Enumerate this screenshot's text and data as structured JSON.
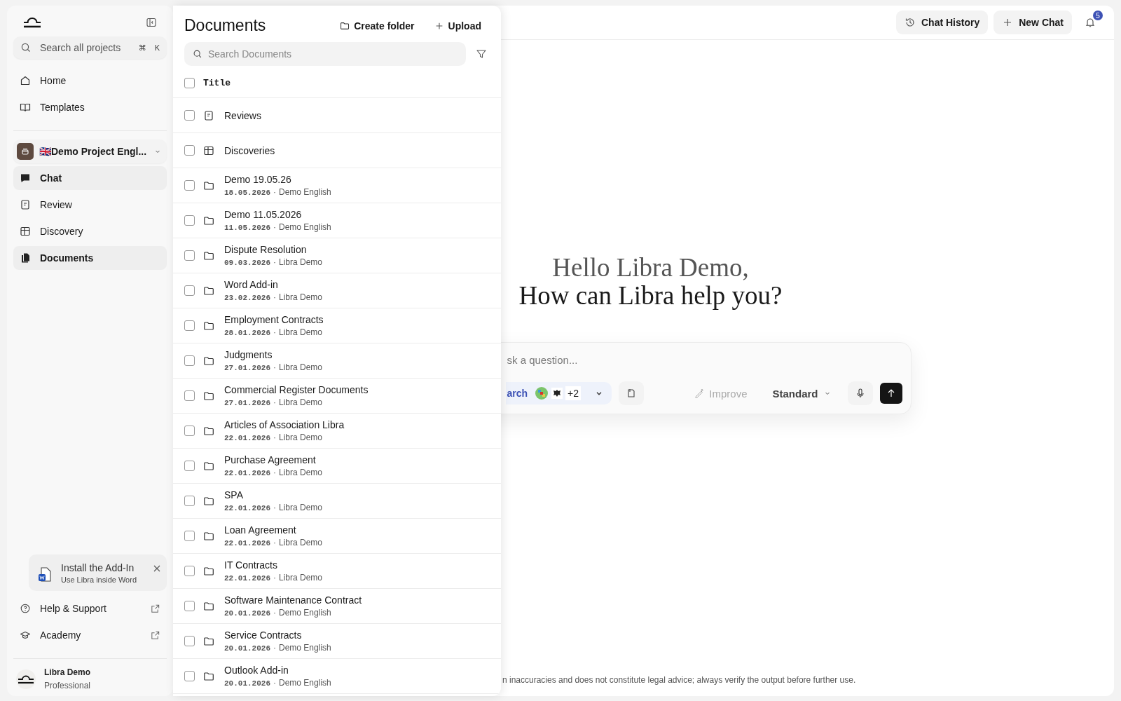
{
  "sidebar": {
    "search": {
      "placeholder": "Search all projects",
      "shortcut": [
        "⌘",
        "K"
      ]
    },
    "nav": [
      {
        "label": "Home",
        "kind": "home"
      },
      {
        "label": "Templates",
        "kind": "book"
      }
    ],
    "project": {
      "name": "🇬🇧Demo Project Engl..."
    },
    "project_nav": [
      {
        "label": "Chat",
        "kind": "chat",
        "selected": true
      },
      {
        "label": "Review",
        "kind": "review",
        "selected": false
      },
      {
        "label": "Discovery",
        "kind": "table",
        "selected": false
      },
      {
        "label": "Documents",
        "kind": "docs",
        "selected": true
      }
    ],
    "addin": {
      "title": "Install the Add-In",
      "subtitle": "Use Libra inside Word"
    },
    "links": [
      {
        "label": "Help & Support",
        "kind": "help"
      },
      {
        "label": "Academy",
        "kind": "academy"
      }
    ],
    "user": {
      "name": "Libra Demo",
      "plan": "Professional"
    }
  },
  "documents": {
    "title": "Documents",
    "actions": [
      {
        "label": "Create folder",
        "kind": "folder"
      },
      {
        "label": "Upload",
        "kind": "plus"
      }
    ],
    "search": {
      "placeholder": "Search Documents"
    },
    "column": "Title",
    "all_checked": false,
    "separator": "·",
    "rows": [
      {
        "title": "Reviews",
        "kind": "review",
        "checked": false
      },
      {
        "title": "Discoveries",
        "kind": "table",
        "checked": false
      },
      {
        "title": "Demo 19.05.26",
        "kind": "folder",
        "date": "18.05.2026",
        "owner": "Demo English",
        "checked": false
      },
      {
        "title": "Demo 11.05.2026",
        "kind": "folder",
        "date": "11.05.2026",
        "owner": "Demo English",
        "checked": false
      },
      {
        "title": "Dispute Resolution",
        "kind": "folder",
        "date": "09.03.2026",
        "owner": "Libra Demo",
        "checked": false
      },
      {
        "title": "Word Add-in",
        "kind": "folder",
        "date": "23.02.2026",
        "owner": "Libra Demo",
        "checked": false
      },
      {
        "title": "Employment Contracts",
        "kind": "folder",
        "date": "28.01.2026",
        "owner": "Libra Demo",
        "checked": false
      },
      {
        "title": "Judgments",
        "kind": "folder",
        "date": "27.01.2026",
        "owner": "Libra Demo",
        "checked": false
      },
      {
        "title": "Commercial Register Documents",
        "kind": "folder",
        "date": "27.01.2026",
        "owner": "Libra Demo",
        "checked": false
      },
      {
        "title": "Articles of Association Libra",
        "kind": "folder",
        "date": "22.01.2026",
        "owner": "Libra Demo",
        "checked": false
      },
      {
        "title": "Purchase Agreement",
        "kind": "folder",
        "date": "22.01.2026",
        "owner": "Libra Demo",
        "checked": false
      },
      {
        "title": "SPA",
        "kind": "folder",
        "date": "22.01.2026",
        "owner": "Libra Demo",
        "checked": false
      },
      {
        "title": "Loan Agreement",
        "kind": "folder",
        "date": "22.01.2026",
        "owner": "Libra Demo",
        "checked": false
      },
      {
        "title": "IT Contracts",
        "kind": "folder",
        "date": "22.01.2026",
        "owner": "Libra Demo",
        "checked": false
      },
      {
        "title": "Software Maintenance Contract",
        "kind": "folder",
        "date": "20.01.2026",
        "owner": "Demo English",
        "checked": false
      },
      {
        "title": "Service Contracts",
        "kind": "folder",
        "date": "20.01.2026",
        "owner": "Demo English",
        "checked": false
      },
      {
        "title": "Outlook Add-in",
        "kind": "folder",
        "date": "20.01.2026",
        "owner": "Demo English",
        "checked": false
      }
    ]
  },
  "header": {
    "buttons": [
      {
        "label": "Chat History",
        "kind": "history"
      },
      {
        "label": "New Chat",
        "kind": "plus"
      }
    ],
    "notifications": "5"
  },
  "greeting": [
    "Hello Libra Demo,",
    "How can Libra help you?"
  ],
  "composer": {
    "placeholder": "sk a question...",
    "search_label": "arch",
    "sources_more": "+2",
    "improve": "Improve",
    "mode": "Standard"
  },
  "disclaimer": "n inaccuracies and does not constitute legal advice; always verify the output before further use."
}
